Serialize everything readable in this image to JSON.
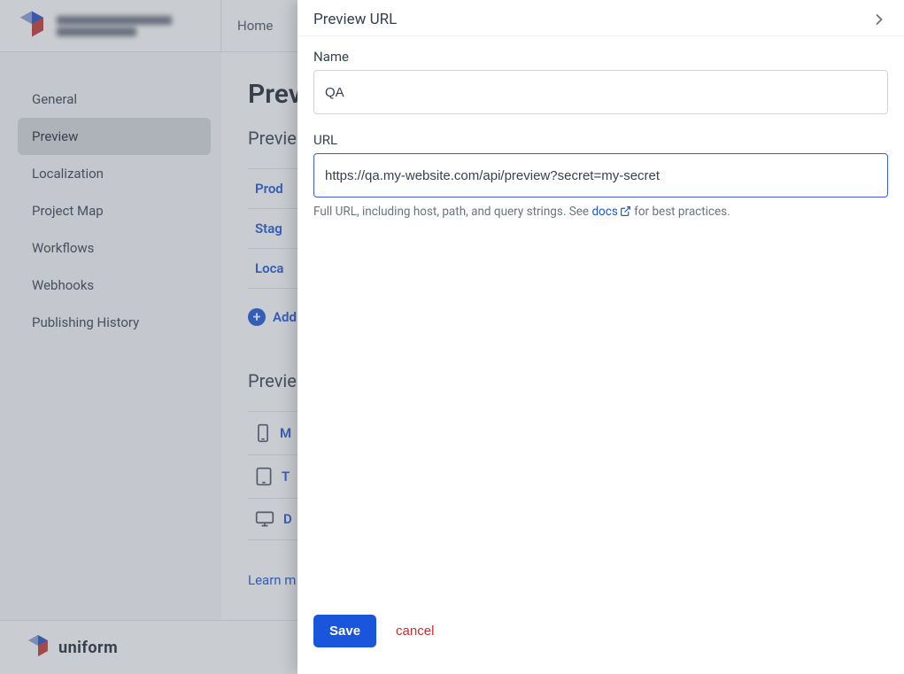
{
  "topbar": {
    "home_label": "Home"
  },
  "sidebar": {
    "items": [
      {
        "label": "General"
      },
      {
        "label": "Preview"
      },
      {
        "label": "Localization"
      },
      {
        "label": "Project Map"
      },
      {
        "label": "Workflows"
      },
      {
        "label": "Webhooks"
      },
      {
        "label": "Publishing History"
      }
    ],
    "active_index": 1
  },
  "main": {
    "page_title_partial": "Previ",
    "section1_title_partial": "Previe",
    "url_rows": [
      "Prod",
      "Stag",
      "Loca"
    ],
    "add_label": "Add",
    "section2_title_partial": "Previe",
    "device_rows": [
      {
        "icon": "mobile",
        "label_partial": "M"
      },
      {
        "icon": "tablet",
        "label_partial": "T"
      },
      {
        "icon": "desktop",
        "label_partial": "D"
      }
    ],
    "learn_more_partial": "Learn m"
  },
  "bottombar": {
    "brand": "uniform"
  },
  "panel": {
    "title": "Preview URL",
    "fields": {
      "name": {
        "label": "Name",
        "value": "QA"
      },
      "url": {
        "label": "URL",
        "value": "https://qa.my-website.com/api/preview?secret=my-secret",
        "help_prefix": "Full URL, including host, path, and query strings. See ",
        "help_link": "docs",
        "help_suffix": "  for best practices."
      }
    },
    "footer": {
      "save_label": "Save",
      "cancel_label": "cancel"
    }
  }
}
